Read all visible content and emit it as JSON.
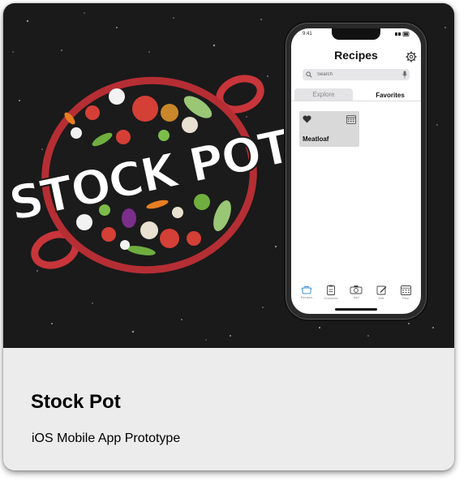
{
  "card": {
    "title": "Stock Pot",
    "subtitle": "iOS Mobile App Prototype"
  },
  "logo": {
    "text": "STOCK POT",
    "pot_color": "#c8353a",
    "background_color": "#1a1a1a"
  },
  "phone": {
    "status_time": "9:41",
    "app_title": "Recipes",
    "search_placeholder": "Search",
    "tabs": [
      {
        "label": "Explore",
        "active": false
      },
      {
        "label": "Favorites",
        "active": true
      }
    ],
    "favorites": [
      {
        "name": "Meatloaf",
        "icon": "heart-icon"
      }
    ],
    "tab_bar": [
      {
        "label": "Recipes",
        "icon": "pot-icon"
      },
      {
        "label": "Groceries",
        "icon": "clipboard-icon"
      },
      {
        "label": "Add",
        "icon": "camera-icon"
      },
      {
        "label": "Edit",
        "icon": "edit-icon"
      },
      {
        "label": "Plan",
        "icon": "calendar-icon"
      }
    ]
  }
}
